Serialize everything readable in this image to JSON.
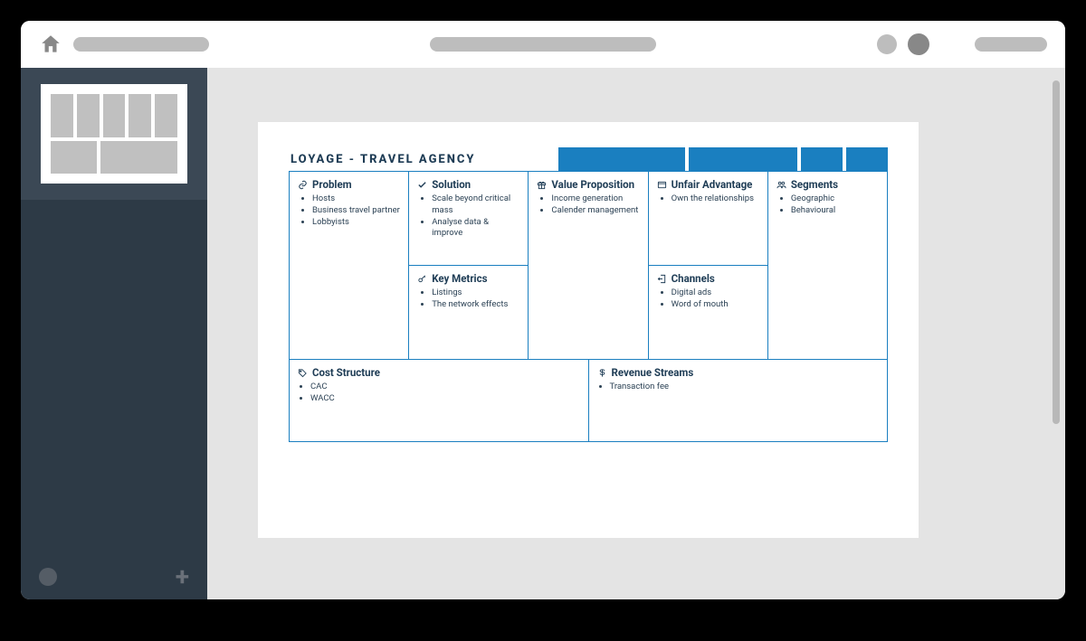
{
  "doc": {
    "title": "LOYAGE - TRAVEL AGENCY"
  },
  "canvas": {
    "problem": {
      "title": "Problem",
      "items": [
        "Hosts",
        "Business travel partner",
        "Lobbyists"
      ]
    },
    "solution": {
      "title": "Solution",
      "items": [
        "Scale beyond critical mass",
        "Analyse data & improve"
      ]
    },
    "key_metrics": {
      "title": "Key Metrics",
      "items": [
        "Listings",
        "The network effects"
      ]
    },
    "value_proposition": {
      "title": "Value Proposition",
      "items": [
        "Income generation",
        "Calender management"
      ]
    },
    "unfair_advantage": {
      "title": "Unfair Advantage",
      "items": [
        "Own the relationships"
      ]
    },
    "channels": {
      "title": "Channels",
      "items": [
        "Digital ads",
        "Word of mouth"
      ]
    },
    "segments": {
      "title": "Segments",
      "items": [
        "Geographic",
        "Behavioural"
      ]
    },
    "cost_structure": {
      "title": "Cost Structure",
      "items": [
        "CAC",
        "WACC"
      ]
    },
    "revenue_streams": {
      "title": "Revenue Streams",
      "items": [
        "Transaction fee"
      ]
    }
  }
}
